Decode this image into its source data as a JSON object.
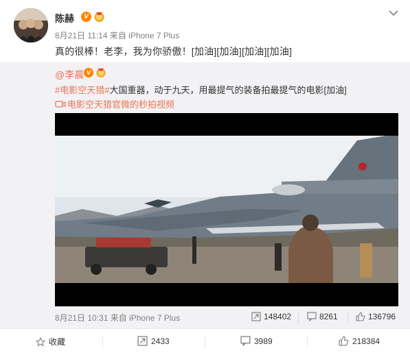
{
  "post": {
    "author": "陈赫",
    "meta": "8月21日 11:14 来自 iPhone 7 Plus",
    "text": "真的很棒！老李，我为你骄傲！[加油][加油][加油][加油]"
  },
  "repost": {
    "author": "@李晨",
    "topic": "#电影空天猎#",
    "text": "大国重器，动于九天，用最提气的装备拍最提气的电影[加油]",
    "link": "电影空天猎官微的秒拍视频",
    "meta": "8月21日 10:31 来自 iPhone 7 Plus",
    "stats": {
      "reposts": "148402",
      "comments": "8261",
      "likes": "136796"
    }
  },
  "actions": {
    "favorite": "收藏",
    "repost": "2433",
    "comment": "3989",
    "like": "218384"
  },
  "colors": {
    "accent": "#eb7350",
    "badge": "#ff8200",
    "repost_bg": "#f2f2f5"
  }
}
